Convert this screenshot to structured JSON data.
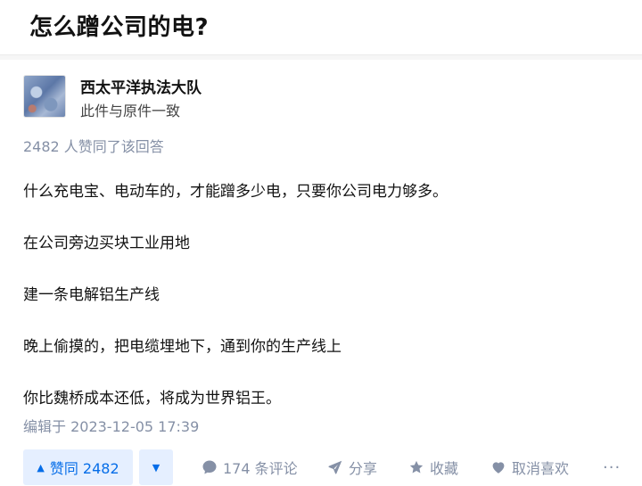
{
  "question": {
    "title": "怎么蹭公司的电?"
  },
  "author": {
    "name": "西太平洋执法大队",
    "headline": "此件与原件一致"
  },
  "answer": {
    "voters_text": "2482 人赞同了该回答",
    "paragraphs": [
      "什么充电宝、电动车的，才能蹭多少电，只要你公司电力够多。",
      "在公司旁边买块工业用地",
      "建一条电解铝生产线",
      "晚上偷摸的，把电缆埋地下，通到你的生产线上",
      "你比魏桥成本还低，将成为世界铝王。"
    ],
    "edited": "编辑于 2023-12-05 17:39"
  },
  "actions": {
    "vote_up_label": "赞同 2482",
    "comment_label": "174 条评论",
    "share_label": "分享",
    "collect_label": "收藏",
    "like_label": "取消喜欢",
    "more_label": "···"
  },
  "icons": {
    "vote_up": "triangle-up-icon",
    "vote_down": "triangle-down-icon",
    "comment": "comment-bubble-icon",
    "share": "paper-plane-icon",
    "collect": "star-icon",
    "like": "heart-icon",
    "more": "ellipsis-icon"
  },
  "colors": {
    "accent": "#056de8",
    "accent_bg": "#e5efff",
    "meta_gray": "#8590a6"
  }
}
